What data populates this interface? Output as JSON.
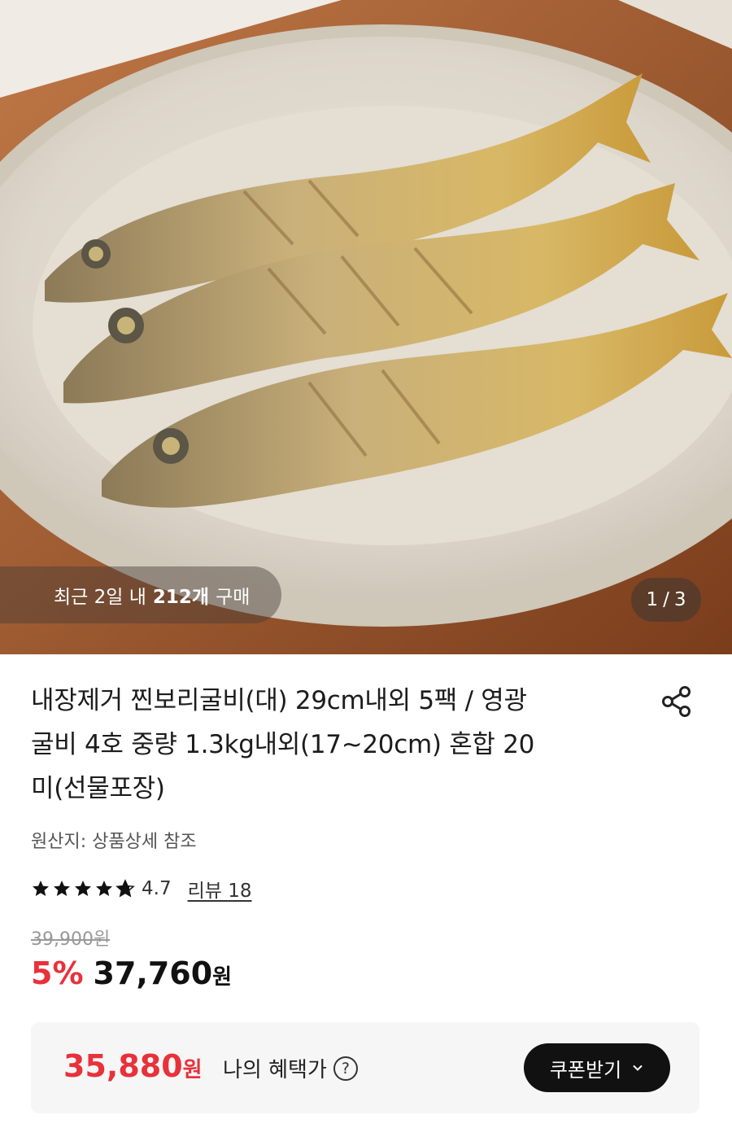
{
  "hero": {
    "purchase_prefix": "최근 2일 내",
    "purchase_count": "212개",
    "purchase_suffix": "구매",
    "page_current": "1",
    "page_sep": "/",
    "page_total": "3"
  },
  "product": {
    "title_lines": [
      "내장제거 찐보리굴비(대) 29cm내외 5팩 / 영광",
      "굴비 4호 중량 1.3kg내외(17~20cm) 혼합 20",
      "미(선물포장)"
    ],
    "origin": "원산지: 상품상세 참조",
    "rating": "4.7",
    "rating_stars": 4.7,
    "review_label": "리뷰 18",
    "original_price": "39,900원",
    "discount": "5%",
    "price": "37,760",
    "price_unit": "원"
  },
  "benefit": {
    "price": "35,880",
    "price_unit": "원",
    "label": "나의 혜택가",
    "help_glyph": "?",
    "coupon_button": "쿠폰받기",
    "coupon_icon": "chevron-down-icon"
  },
  "colors": {
    "accent_red": "#e8313a",
    "button_dark": "#111111"
  }
}
